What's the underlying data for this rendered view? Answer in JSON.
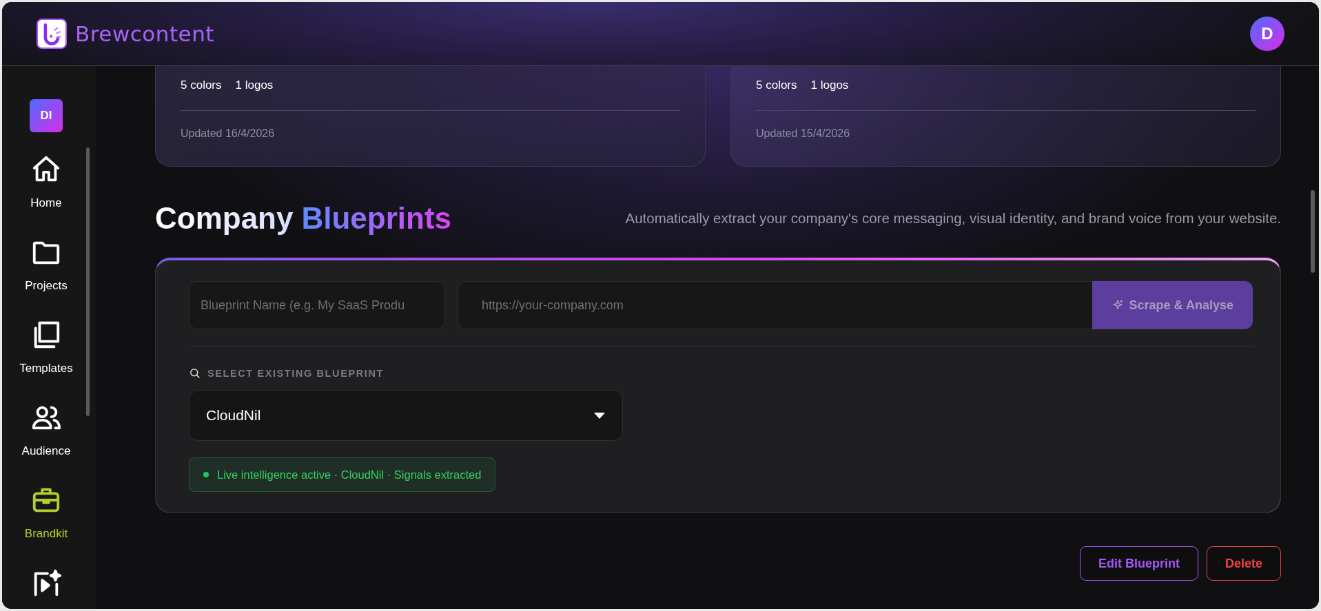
{
  "header": {
    "brand": "Brewcontent",
    "avatar": "D"
  },
  "sidebar": {
    "workspace": "DI",
    "items": [
      {
        "kind": "home",
        "label": "Home",
        "selected": false
      },
      {
        "kind": "folder",
        "label": "Projects",
        "selected": false
      },
      {
        "kind": "templates",
        "label": "Templates",
        "selected": false
      },
      {
        "kind": "audience",
        "label": "Audience",
        "selected": false
      },
      {
        "kind": "brandkit",
        "label": "Brandkit",
        "selected": true
      },
      {
        "kind": "video",
        "selected": false
      }
    ]
  },
  "brand_cards": [
    {
      "stats": [
        "5 colors",
        "1 logos"
      ],
      "updated": "Updated 16/4/2026"
    },
    {
      "stats": [
        "5 colors",
        "1 logos"
      ],
      "updated": "Updated 15/4/2026"
    }
  ],
  "section": {
    "title": "Company",
    "title_accent": "Blueprints",
    "description": "Automatically extract your company's core messaging, visual identity, and brand voice from your website."
  },
  "blueprint_form": {
    "name_field": {
      "placeholder": "Blueprint Name (e.g. My SaaS Produ"
    },
    "url_field": {
      "placeholder": "https://your-company.com"
    },
    "scrape_button": {
      "label": "Scrape & Analyse",
      "disabled": true
    },
    "select_label": "SELECT EXISTING BLUEPRINT",
    "select": {
      "value": "CloudNil"
    },
    "status": {
      "text": "Live intelligence active · CloudNil · Signals extracted",
      "active": true
    }
  },
  "actions": [
    {
      "kind": "edit",
      "label": "Edit Blueprint"
    },
    {
      "kind": "delete",
      "label": "Delete"
    }
  ]
}
